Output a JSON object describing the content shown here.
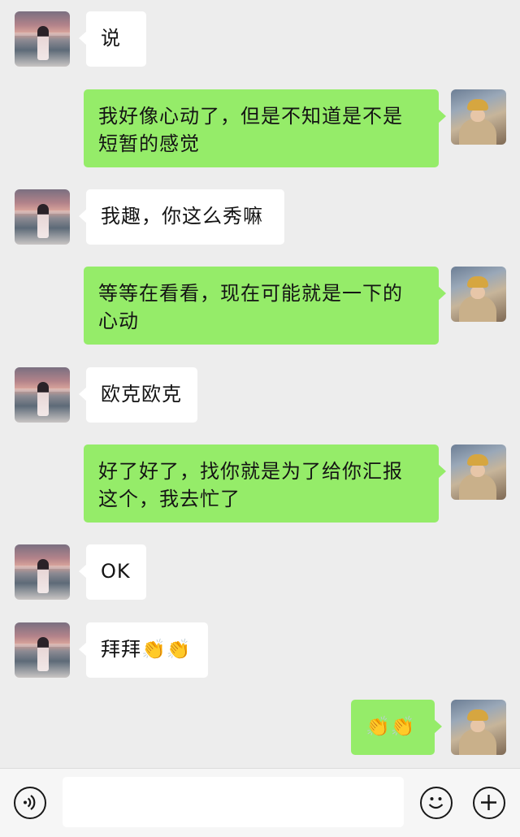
{
  "messages": [
    {
      "sender": "contact",
      "text": "说"
    },
    {
      "sender": "me",
      "text": "我好像心动了，但是不知道是不是\n短暂的感觉"
    },
    {
      "sender": "contact",
      "text": "我趣，你这么秀嘛"
    },
    {
      "sender": "me",
      "text": "等等在看看，现在可能就是一下的\n心动"
    },
    {
      "sender": "contact",
      "text": "欧克欧克"
    },
    {
      "sender": "me",
      "text": "好了好了，找你就是为了给你汇报\n这个，我去忙了"
    },
    {
      "sender": "contact",
      "text": "OK"
    },
    {
      "sender": "contact",
      "text": "拜拜👏👏"
    },
    {
      "sender": "me",
      "text": "👏👏"
    }
  ],
  "input_bar": {
    "voice_icon": "voice-icon",
    "emoji_icon": "emoji-icon",
    "plus_icon": "plus-icon",
    "input_value": ""
  },
  "colors": {
    "background": "#ededed",
    "my_bubble": "#95ec69",
    "their_bubble": "#ffffff"
  }
}
